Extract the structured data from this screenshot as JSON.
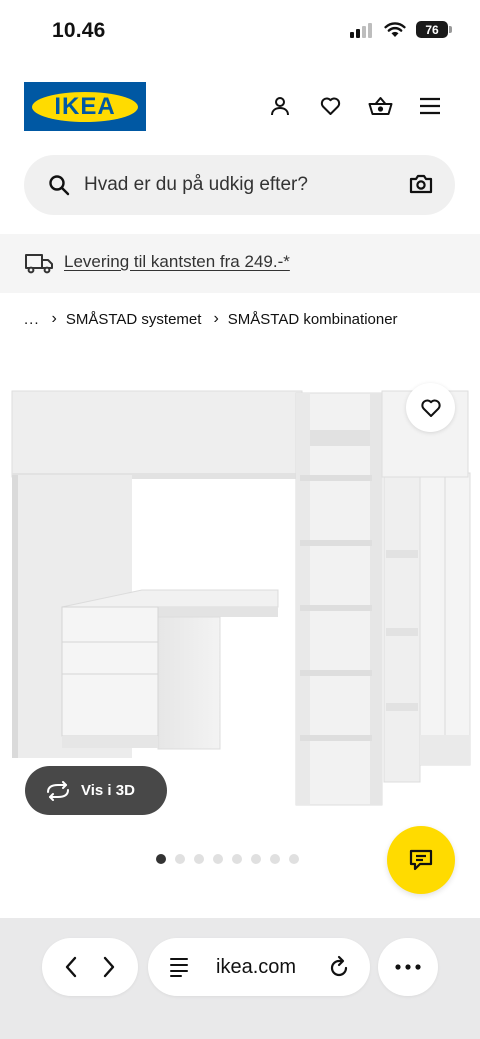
{
  "status_bar": {
    "time": "10.46",
    "battery": "76"
  },
  "header": {
    "logo_text": "IKEA",
    "brand_blue": "#0058a3",
    "brand_yellow": "#ffdb00"
  },
  "search": {
    "placeholder": "Hvad er du på udkig efter?"
  },
  "delivery": {
    "text": "Levering til kantsten fra 249.-*"
  },
  "breadcrumb": {
    "ellipsis": "...",
    "items": [
      "SMÅSTAD systemet",
      "SMÅSTAD kombinationer"
    ]
  },
  "product": {
    "view3d_label": "Vis i 3D",
    "image_count": 8,
    "active_image": 1
  },
  "browser": {
    "url": "ikea.com"
  },
  "icons": {
    "header": [
      "profile-icon",
      "heart-icon",
      "basket-icon",
      "menu-icon"
    ],
    "search": [
      "search-icon",
      "camera-icon"
    ],
    "delivery": "truck-icon",
    "product": [
      "heart-icon",
      "rotate-3d-icon",
      "chat-icon"
    ],
    "browser": [
      "back-icon",
      "forward-icon",
      "reader-icon",
      "reload-icon",
      "more-icon"
    ]
  }
}
